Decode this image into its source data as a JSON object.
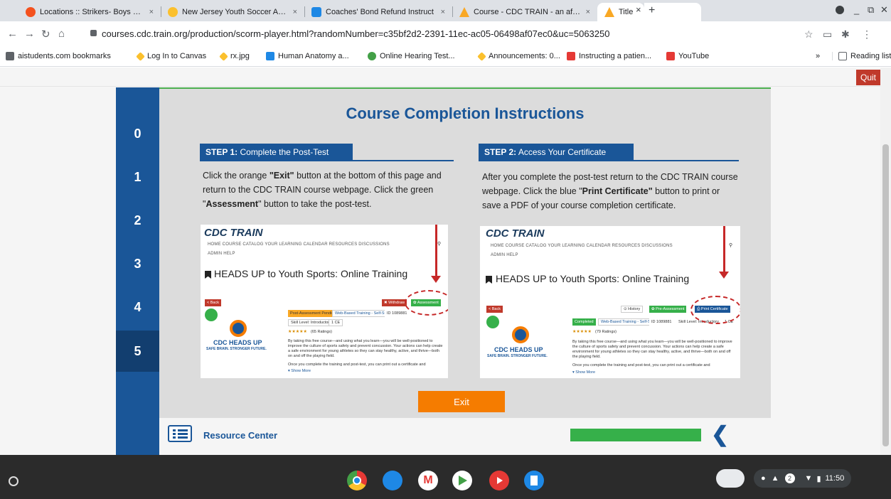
{
  "browser": {
    "tabs": [
      {
        "title": "Locations :: Strikers- Boys U13",
        "color": "#f4511e"
      },
      {
        "title": "New Jersey Youth Soccer Asso",
        "color": "#fbc02d"
      },
      {
        "title": "Coaches' Bond Refund Instruct",
        "color": "#1e88e5"
      },
      {
        "title": "Course - CDC TRAIN - an affilia",
        "color": "#f9a825"
      },
      {
        "title": "Title",
        "color": "#f9a825"
      }
    ],
    "tab_close": "×",
    "new_tab": "+",
    "url": "courses.cdc.train.org/production/scorm-player.html?randomNumber=c35bf2d2-2391-11ec-ac05-06498af07ec0&uc=5063250",
    "bookmarks": [
      {
        "label": "aistudents.com bookmarks",
        "color": "#5f6368"
      },
      {
        "label": "Log In to Canvas",
        "color": "#fbc02d"
      },
      {
        "label": "rx.jpg",
        "color": "#fbc02d"
      },
      {
        "label": "Human Anatomy a...",
        "color": "#1e88e5"
      },
      {
        "label": "Online Hearing Test...",
        "color": "#43a047"
      },
      {
        "label": "Announcements: 0...",
        "color": "#fbc02d"
      },
      {
        "label": "Instructing a patien...",
        "color": "#e53935"
      },
      {
        "label": "YouTube",
        "color": "#e53935"
      }
    ],
    "more_bookmarks": "»",
    "reading_list": "Reading list"
  },
  "course": {
    "quit_label": "Quit",
    "nav_numbers": [
      "0",
      "1",
      "2",
      "3",
      "4",
      "5"
    ],
    "current_index": 5,
    "title": "Course Completion Instructions",
    "step1": {
      "label_bold": "STEP 1:",
      "label_rest": " Complete the Post-Test",
      "t1": "Click the orange ",
      "b1": "\"Exit\"",
      "t2": " button at the bottom of this page and return to the CDC TRAIN course webpage. Click the green \"",
      "b2": "Assessment",
      "t3": "\" button to take the post-test."
    },
    "step2": {
      "label_bold": "STEP 2:",
      "label_rest": " Access Your Certificate",
      "t1": "After you complete the post-test return to the CDC TRAIN course webpage. Click the blue \"",
      "b1": "Print Certificate\"",
      "t2": " button to print or save a PDF of your course completion certificate."
    },
    "screenshot": {
      "brand": "CDC TRAIN",
      "menu1": "HOME   COURSE CATALOG   YOUR LEARNING   CALENDAR   RESOURCES   DISCUSSIONS",
      "menu2": "ADMIN   HELP",
      "course_title": "HEADS UP to Youth Sports: Online Training",
      "back": "< Back",
      "withdraw": "✖ Withdraw",
      "assessment": "✿ Assessment",
      "history": "⊙ History",
      "pre_assessment": "✿ Pre-Assessment",
      "print_certificate": "⎙ Print Certificate",
      "heads_up": "CDC HEADS UP",
      "tagline": "SAFE BRAIN. STRONGER FUTURE.",
      "stars": "★★★★★",
      "ratings1": "(65 Ratings)",
      "ratings2": "(79 Ratings)",
      "tag_pending": "Post-Assessment Pending",
      "tag_completed": "Completed",
      "tag_web": "Web-Based Training - Self-Study",
      "course_id1": "ID 1089881",
      "course_id2": "ID 1089881",
      "skill": "Skill Level: Introductory",
      "skill2": "Skill Level: Introductory",
      "credit": "1 CE",
      "desc1": "By taking this free course—and using what you learn—you will be well-positioned to improve the culture of sports safety and prevent concussion. Your actions can help create a safe environment for young athletes so they can stay healthy, active, and thrive—both on and off the playing field.",
      "desc2": "Once you complete the training and post-test, you can print out a certificate and",
      "show_more": "▾ Show More"
    },
    "exit_label": "Exit",
    "resource_center": "Resource Center",
    "progress": 1.0
  },
  "shelf": {
    "apps": [
      {
        "name": "chrome",
        "color": "#1e88e5"
      },
      {
        "name": "files",
        "color": "#1e88e5"
      },
      {
        "name": "gmail",
        "color": "#e53935"
      },
      {
        "name": "play-store",
        "color": "#43a047"
      },
      {
        "name": "youtube",
        "color": "#e53935"
      },
      {
        "name": "docs",
        "color": "#1e88e5"
      }
    ],
    "notification_count": "2",
    "time": "11:50"
  }
}
